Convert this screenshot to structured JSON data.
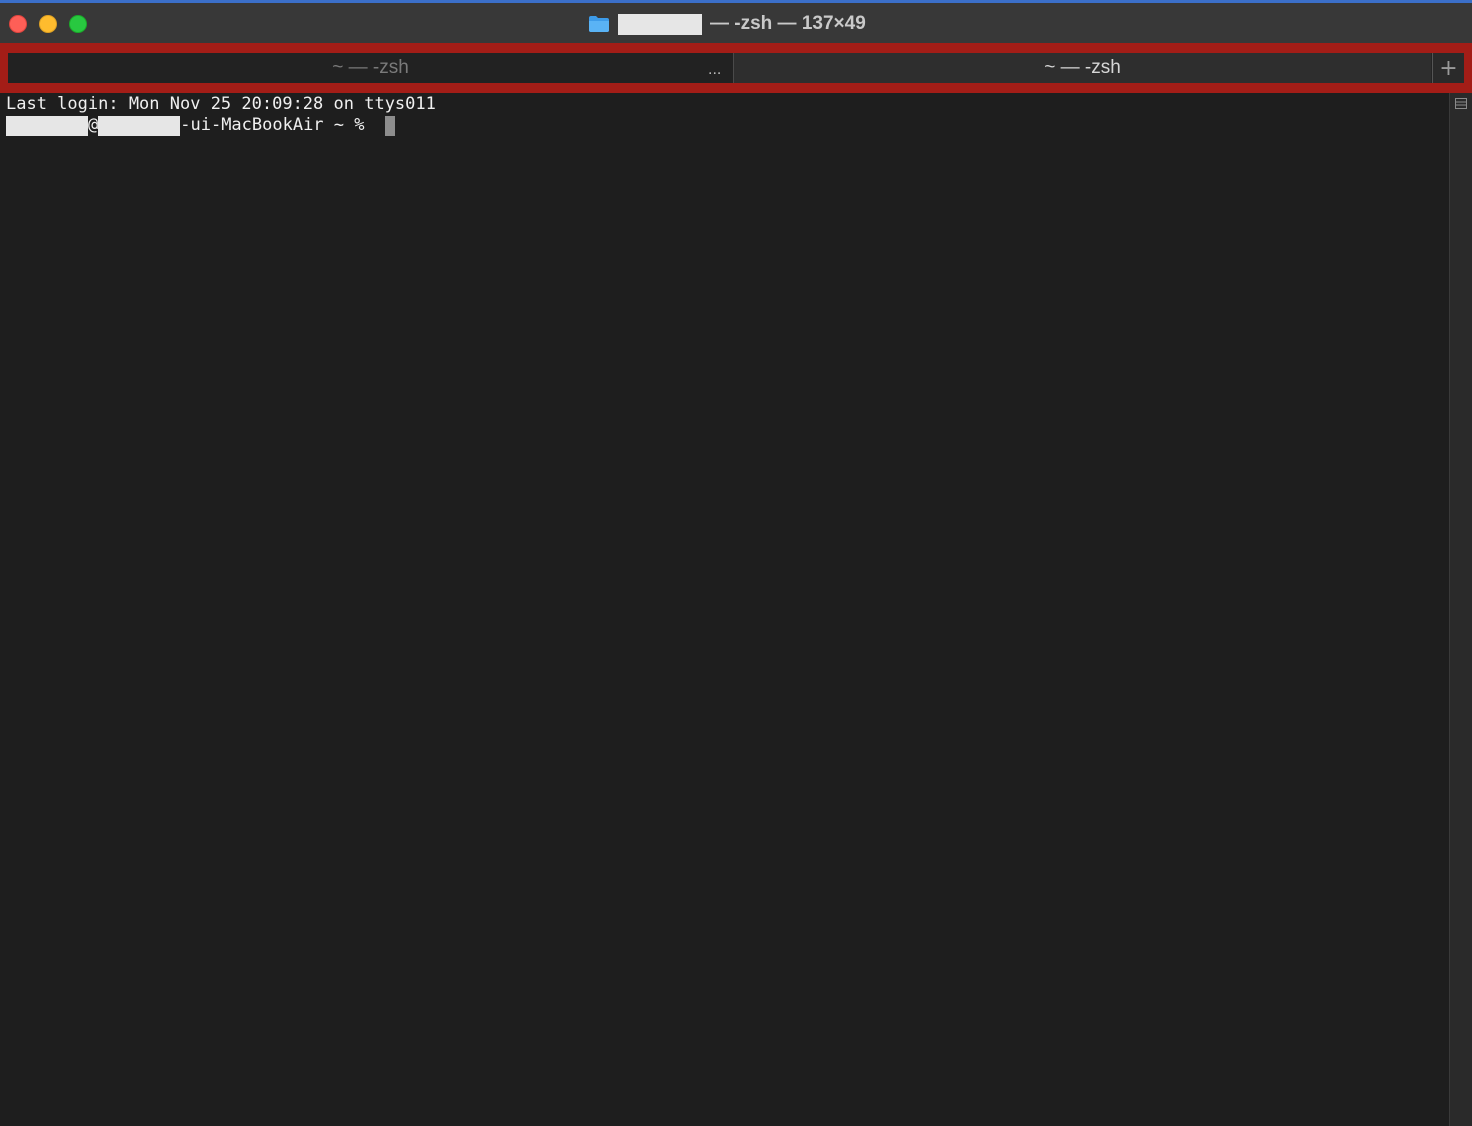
{
  "window": {
    "title_suffix": "— -zsh — 137×49"
  },
  "tabs": [
    {
      "label": "~ — -zsh",
      "active": false,
      "overflow": "..."
    },
    {
      "label": "~ — -zsh",
      "active": true
    }
  ],
  "new_tab": {
    "label": "+"
  },
  "terminal": {
    "last_login": "Last login: Mon Nov 25 20:09:28 on ttys011",
    "prompt_at": "@",
    "prompt_host_suffix": "-ui-MacBookAir ~ % "
  },
  "colors": {
    "tabbar_highlight": "#a31d17",
    "background": "#1e1e1e",
    "text": "#f0f0f0"
  },
  "icons": {
    "close": "close-button",
    "minimize": "minimize-button",
    "zoom": "zoom-button",
    "folder": "folder-icon",
    "split": "split-pane-icon",
    "more": "ellipsis-icon"
  }
}
